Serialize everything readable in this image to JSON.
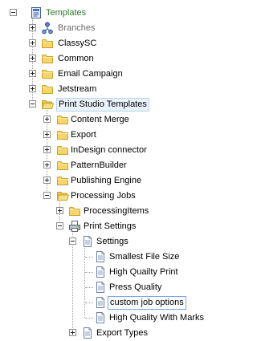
{
  "tree": {
    "root": {
      "label": "Templates",
      "icon": "templates-doc-icon",
      "expanded": true
    },
    "nodes": [
      {
        "key": "branches",
        "label": "Branches",
        "icon": "branches-icon",
        "expander": "plus"
      },
      {
        "key": "classysc",
        "label": "ClassySC",
        "icon": "folder-icon",
        "expander": "plus"
      },
      {
        "key": "common",
        "label": "Common",
        "icon": "folder-icon",
        "expander": "plus"
      },
      {
        "key": "email-campaign",
        "label": "Email Campaign",
        "icon": "folder-icon",
        "expander": "plus"
      },
      {
        "key": "jetstream",
        "label": "Jetstream",
        "icon": "folder-icon",
        "expander": "plus"
      },
      {
        "key": "print-studio-templates",
        "label": "Print Studio Templates",
        "icon": "folder-open-icon",
        "expander": "minus"
      },
      {
        "key": "content-merge",
        "label": "Content Merge",
        "icon": "folder-icon",
        "expander": "plus"
      },
      {
        "key": "export",
        "label": "Export",
        "icon": "folder-icon",
        "expander": "plus"
      },
      {
        "key": "indesign-connector",
        "label": "InDesign connector",
        "icon": "folder-icon",
        "expander": "plus"
      },
      {
        "key": "patternbuilder",
        "label": "PatternBuilder",
        "icon": "folder-icon",
        "expander": "plus"
      },
      {
        "key": "publishing-engine",
        "label": "Publishing Engine",
        "icon": "folder-icon",
        "expander": "plus"
      },
      {
        "key": "processing-jobs",
        "label": "Processing Jobs",
        "icon": "folder-open-icon",
        "expander": "minus"
      },
      {
        "key": "processingitems",
        "label": "ProcessingItems",
        "icon": "folder-icon",
        "expander": "plus"
      },
      {
        "key": "print-settings",
        "label": "Print Settings",
        "icon": "printer-icon",
        "expander": "minus"
      },
      {
        "key": "settings",
        "label": "Settings",
        "icon": "document-icon",
        "expander": "minus"
      },
      {
        "key": "smallest-file-size",
        "label": "Smallest File Size",
        "icon": "document-icon",
        "expander": "none"
      },
      {
        "key": "high-quality-print",
        "label": "High Quailty Print",
        "icon": "document-icon",
        "expander": "none"
      },
      {
        "key": "press-quality",
        "label": "Press Quality",
        "icon": "document-icon",
        "expander": "none"
      },
      {
        "key": "custom-job-options",
        "label": "custom job options",
        "icon": "document-icon",
        "expander": "none",
        "selected": true
      },
      {
        "key": "high-quality-with-marks",
        "label": "High Quality With Marks",
        "icon": "document-icon",
        "expander": "none"
      },
      {
        "key": "export-types",
        "label": "Export Types",
        "icon": "document-icon",
        "expander": "plus"
      }
    ]
  },
  "colors": {
    "root_label": "#2d7a2d",
    "branches_label": "#6b6b6b",
    "selection_bg": "#e9f1fb",
    "folder_fill": "#f5d66b",
    "folder_stroke": "#c9a227"
  }
}
